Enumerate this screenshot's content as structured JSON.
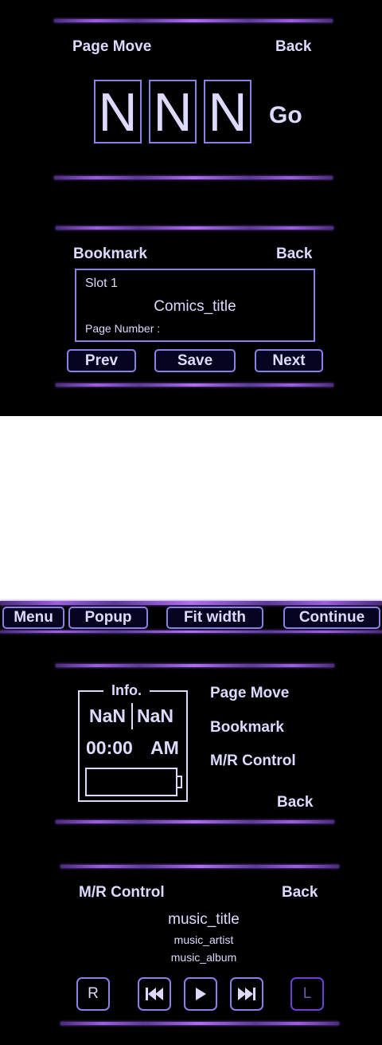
{
  "page_move": {
    "title": "Page Move",
    "back": "Back",
    "digits": [
      "N",
      "N",
      "N"
    ],
    "go": "Go"
  },
  "bookmark": {
    "title": "Bookmark",
    "back": "Back",
    "slot": "Slot 1",
    "comic_title": "Comics_title",
    "page_number_label": "Page Number :",
    "prev": "Prev",
    "save": "Save",
    "next": "Next"
  },
  "toolbar": {
    "menu": "Menu",
    "popup": "Popup",
    "fit_width": "Fit width",
    "continue": "Continue"
  },
  "info_menu": {
    "info_title": "Info.",
    "left_value": "NaN",
    "right_value": "NaN",
    "time": "00:00",
    "ampm": "AM",
    "items": [
      "Page Move",
      "Bookmark",
      "M/R Control"
    ],
    "back": "Back"
  },
  "mr_control": {
    "title": "M/R Control",
    "back": "Back",
    "music_title": "music_title",
    "music_artist": "music_artist",
    "music_album": "music_album",
    "r_label": "R",
    "l_label": "L"
  },
  "colors": {
    "panel_bg": "#000000",
    "accent_border": "#8a80e8",
    "text": "#dcdaff",
    "divider": "#9d5fe0"
  }
}
